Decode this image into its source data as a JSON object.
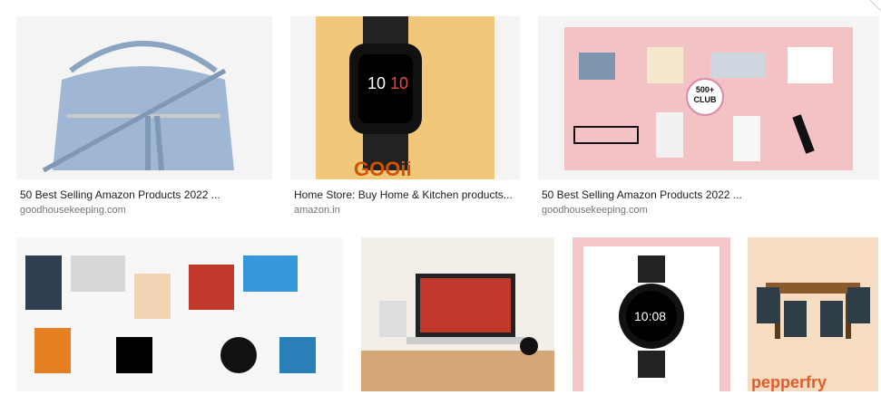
{
  "results": [
    {
      "title": "50 Best Selling Amazon Products 2022 ...",
      "source": "goodhousekeeping.com",
      "alt": "Light blue crossbody bag with tassels"
    },
    {
      "title": "Home Store: Buy Home & Kitchen products...",
      "source": "amazon.in",
      "alt": "Black smartwatch on yellow background",
      "logo_text": "GOOii"
    },
    {
      "title": "50 Best Selling Amazon Products 2022 ...",
      "source": "goodhousekeeping.com",
      "alt": "Collage of products on pink background",
      "badge_top": "500+",
      "badge_bottom": "CLUB"
    },
    {
      "alt": "Collage of many consumer products"
    },
    {
      "alt": "Laptop and accessories on a wooden desk"
    },
    {
      "alt": "Round black smartwatch",
      "time": "10:08"
    },
    {
      "alt": "Dining table set",
      "logo_text": "pepperfry"
    }
  ],
  "colors": {
    "bag": "#9fb6d4",
    "yellow": "#f1c77a",
    "pink": "#f3c2c5",
    "peach": "#f6dcc0"
  }
}
